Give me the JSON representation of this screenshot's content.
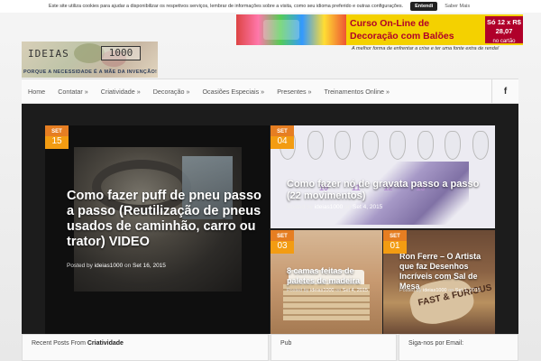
{
  "cookie": {
    "text": "Este site utiliza cookies para ajudar a disponibilizar os respetivos serviços, lembrar de informações sobre a visita, como seu idioma preferido e outras configurações.",
    "accept_label": "Entendi",
    "more_label": "Saber Mais"
  },
  "logo": {
    "word": "IDEIAS",
    "number": "1000",
    "tagline": "PORQUE A NECESSIDADE É A MÃE DA INVENÇÃO!"
  },
  "ad": {
    "line1": "Curso On-Line de",
    "line2": "Decoração com Balões",
    "price_line1": "Só 12 x R$ 28,07",
    "price_line2": "no cartão",
    "tagline": "A melhor forma de enfrentar a crise e ter uma fonte extra de renda!"
  },
  "nav": {
    "items": [
      "Home",
      "Contatar »",
      "Criatividade »",
      "Decoração »",
      "Ocasiões Especiais »",
      "Presentes »",
      "Treinamentos Online »"
    ],
    "social_icon": "facebook-icon",
    "social_glyph": "f"
  },
  "featured": [
    {
      "month": "SET",
      "day": "15",
      "title": "Como fazer puff de pneu passo a passo (Reutilização de pneus usados de caminhão, carro ou trator) VIDEO",
      "meta_prefix": "Posted by",
      "author": "ideias1000",
      "meta_on": "on",
      "date": "Set 16, 2015"
    },
    {
      "month": "SET",
      "day": "04",
      "title": "Como fazer nó de gravata passo a passo (22 movimentos)",
      "meta_prefix": "Posted by",
      "author": "ideias1000",
      "meta_on": "on",
      "date": "Set 4, 2015"
    },
    {
      "month": "SET",
      "day": "03",
      "title": "8 camas feitas de paletes de madeira",
      "meta_prefix": "Posted by",
      "author": "ideias1000",
      "meta_on": "on",
      "date": "Set 4, 2015"
    },
    {
      "month": "SET",
      "day": "01",
      "title": "Ron Ferre – O Artista que faz Desenhos Incríveis com Sal de Mesa",
      "meta_prefix": "Posted by",
      "author": "ideias1000",
      "meta_on": "on",
      "date": "Set 1, 2015"
    }
  ],
  "tie_steps": [
    "10",
    "11",
    "12",
    "13"
  ],
  "art_salt_text": "FAST & FURIOUS",
  "widgets": {
    "recent_prefix": "Recent Posts From",
    "recent_category": "Criatividade",
    "pub": "Pub",
    "follow": "Siga-nos por Email:"
  },
  "colors": {
    "badge": "#f39c12",
    "ad_red": "#b0002a",
    "ad_yellow": "#f4d100"
  }
}
